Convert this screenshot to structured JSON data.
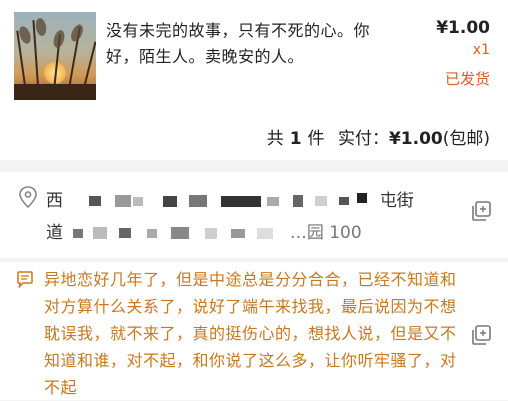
{
  "order": {
    "title": "没有未完的故事，只有不死的心。你好，陌生人。卖晚安的人。",
    "price": "¥1.00",
    "quantity": "x1",
    "status": "已发货",
    "summary_prefix": "共",
    "item_count": "1",
    "summary_unit": "件",
    "paid_label": "实付：",
    "paid_amount": "¥1.00",
    "shipping_note": "(包邮)"
  },
  "address": {
    "line1_start": "西",
    "line1_end": "屯街",
    "line2_start": "道",
    "line2_end": "…园 100"
  },
  "message": {
    "text": "异地恋好几年了，但是中途总是分分合合，已经不知道和对方算什么关系了，说好了端午来找我，最后说因为不想耽误我，就不来了，真的挺伤心的，想找人说，但是又不知道和谁，对不起，和你说了这么多，让你听牢骚了，对不起"
  },
  "icons": {
    "location": "location-pin-icon",
    "copy": "copy-icon",
    "message": "message-bubble-icon"
  },
  "colors": {
    "accent": "#e05a2a",
    "message_text": "#c8781d"
  }
}
